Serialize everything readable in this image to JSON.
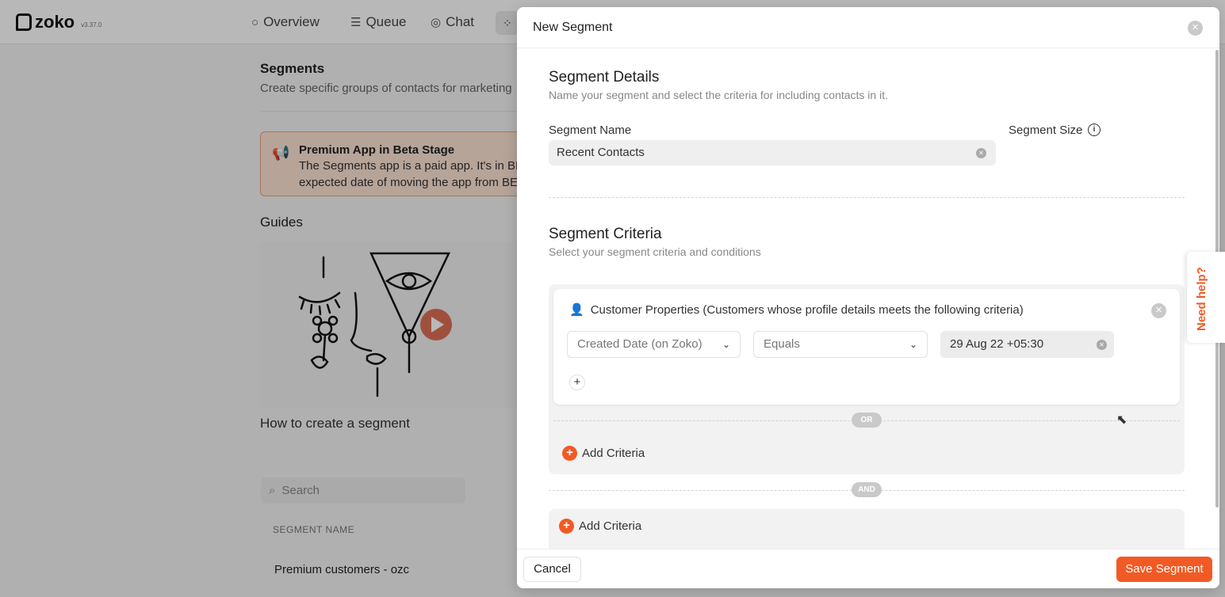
{
  "app": {
    "logo_text": "zoko",
    "version": "v3.37.0"
  },
  "nav": {
    "overview": "Overview",
    "queue": "Queue",
    "chat": "Chat"
  },
  "background": {
    "page_title": "Segments",
    "page_subtitle": "Create specific groups of contacts for marketing",
    "beta_title": "Premium App in Beta Stage",
    "beta_line1": "The Segments app is a paid app. It's in BE",
    "beta_line2": "expected date of moving the app from BE",
    "guides_title": "Guides",
    "guide_caption": "How to create a segment",
    "search_placeholder": "Search",
    "column_header": "SEGMENT NAME",
    "first_row": "Premium customers - ozc"
  },
  "modal": {
    "title": "New Segment",
    "details_heading": "Segment Details",
    "details_subtitle": "Name your segment and select the criteria for including contacts in it.",
    "name_label": "Segment Name",
    "name_value": "Recent Contacts",
    "size_label": "Segment Size",
    "criteria_heading": "Segment Criteria",
    "criteria_subtitle": "Select your segment criteria and conditions",
    "criteria_card": {
      "title": "Customer Properties (Customers whose profile details meets the following criteria)",
      "field": "Created Date (on Zoko)",
      "operator": "Equals",
      "value": "29 Aug 22 +05:30"
    },
    "or_label": "OR",
    "and_label": "AND",
    "add_criteria_inner": "Add Criteria",
    "add_criteria_outer": "Add Criteria",
    "cancel_label": "Cancel",
    "save_label": "Save Segment"
  },
  "help": {
    "label": "Need help?"
  },
  "colors": {
    "accent": "#f15a24",
    "beta_bg": "#fde3d5"
  }
}
